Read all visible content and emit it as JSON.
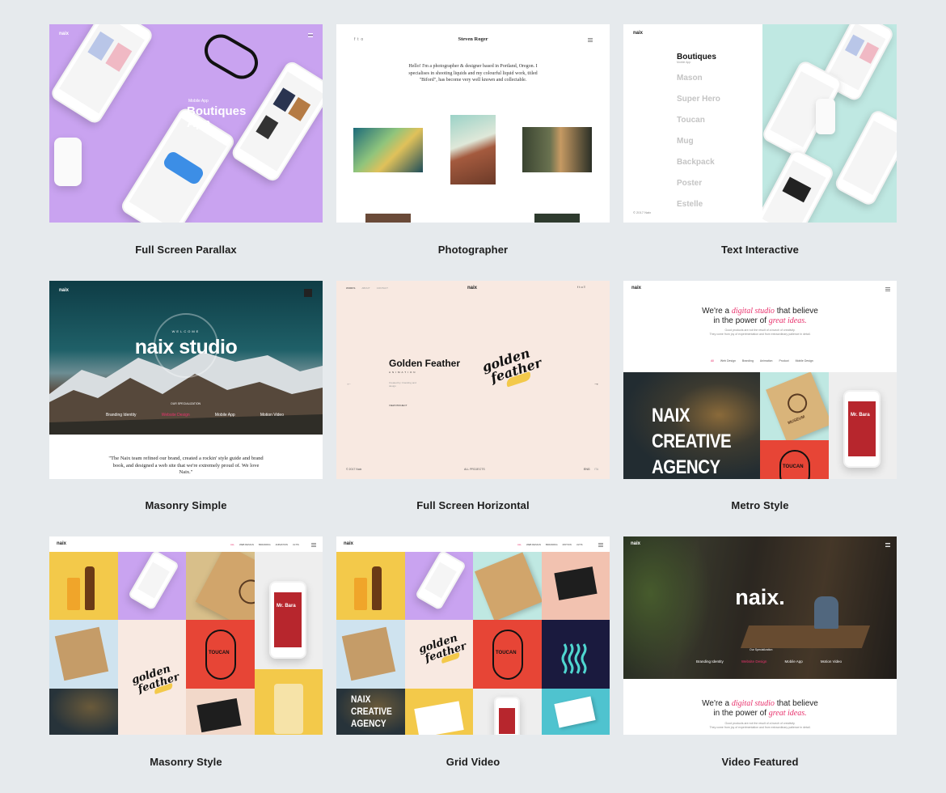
{
  "templates": [
    {
      "caption": "Full Screen Parallax"
    },
    {
      "caption": "Photographer"
    },
    {
      "caption": "Text Interactive"
    },
    {
      "caption": "Masonry Simple"
    },
    {
      "caption": "Full Screen Horizontal"
    },
    {
      "caption": "Metro Style"
    },
    {
      "caption": "Masonry Style"
    },
    {
      "caption": "Grid Video"
    },
    {
      "caption": "Video Featured"
    }
  ],
  "parallax": {
    "logo": "naix",
    "tag": "Mobile App",
    "title": "Boutiques App",
    "colors": {
      "bg": "#c9a3f0"
    }
  },
  "photographer": {
    "name": "Steven Roger",
    "intro": "Hello! I'm a photographer & designer based in Portland, Oregon. I specialises in shooting liquids and my colourful liquid work, titled \"Biford\", has become very well known and collectable."
  },
  "text_interactive": {
    "logo": "naix",
    "items": [
      "Boutiques",
      "Mason",
      "Super Hero",
      "Toucan",
      "Mug",
      "Backpack",
      "Poster",
      "Estelle"
    ],
    "active_sub": "Mobile App",
    "footer": "© 2017 Naix",
    "colors": {
      "bg": "#bfe8e2"
    }
  },
  "masonry_simple": {
    "logo": "naix",
    "welcome": "WELCOME",
    "title": "naix studio",
    "specialization": "OUR SPECIALIZATION",
    "services": [
      "Branding Identity",
      "Website Design",
      "Mobile App",
      "Motion Video"
    ],
    "quote": "\"The Naix team refined our brand, created a rockin' style guide and brand book, and designed a web site that we're extremely proud of. We love Naix.\""
  },
  "horizontal": {
    "logo": "naix",
    "nav": [
      "WORKS",
      "ABOUT",
      "CONTACT"
    ],
    "title": "Golden Feather",
    "subtitle": "ANIMATION",
    "desc": "Created by: branding and design",
    "view": "VIEW PROJECT",
    "footer_left": "© 2017 Naix",
    "footer_mid": "ALL PROJECTS",
    "footer_right": "ENG",
    "footer_right2": "ITA",
    "logo_line1": "golden",
    "logo_line2": "feather"
  },
  "metro": {
    "logo": "naix",
    "headline_1": "We're a",
    "headline_2": "digital studio",
    "headline_3": "that believe",
    "headline_4": "in the power of",
    "headline_5": "great ideas.",
    "small_1": "Good products are not the result of a bunch of creativity.",
    "small_2": "They come from joy of experimentation and from extraordinary patience in detail.",
    "filters": [
      "All",
      "Web Design",
      "Branding",
      "Animation",
      "Product",
      "Mobile Design"
    ],
    "agency_1": "NAIX",
    "agency_2": "CREATIVE",
    "agency_3": "AGENCY",
    "toucan": "TOUCAN",
    "book": "MUSEUM",
    "phone_text": "Mr. Bara"
  },
  "masonry_style": {
    "logo": "naix",
    "nav": [
      "ALL",
      "WEB DESIGN",
      "BRANDING",
      "ANIMATION",
      "ULTIS"
    ],
    "toucan": "TOUCAN",
    "golden": "golden",
    "feather": "feather",
    "phone_text": "Mr. Bara"
  },
  "grid_video": {
    "logo": "naix",
    "nav": [
      "ALL",
      "WEB DESIGN",
      "BRANDING",
      "MOTION",
      "ULTIS"
    ],
    "toucan": "TOUCAN",
    "golden": "golden",
    "feather": "feather",
    "agency_1": "NAIX",
    "agency_2": "CREATIVE",
    "agency_3": "AGENCY"
  },
  "video_featured": {
    "logo": "naix",
    "title": "naix.",
    "specialization": "Our Specialization",
    "services": [
      "Branding Identity",
      "Website Design",
      "Mobile App",
      "Motion Video"
    ],
    "headline_1": "We're a",
    "headline_2": "digital studio",
    "headline_3": "that believe",
    "headline_4": "in the power of",
    "headline_5": "great ideas.",
    "small_1": "Good products are not the result of a bunch of creativity.",
    "small_2": "They come from joy of experimentation and from extraordinary patience in detail."
  },
  "colors": {
    "page_bg": "#e6eaed",
    "accent_pink": "#e8336d",
    "toucan_red": "#e74536",
    "leaf_dark": "#27333a",
    "yellow": "#f3c94a",
    "lavender": "#c9a3f0",
    "mint": "#bfe8e2",
    "peach": "#f8e9e1"
  }
}
